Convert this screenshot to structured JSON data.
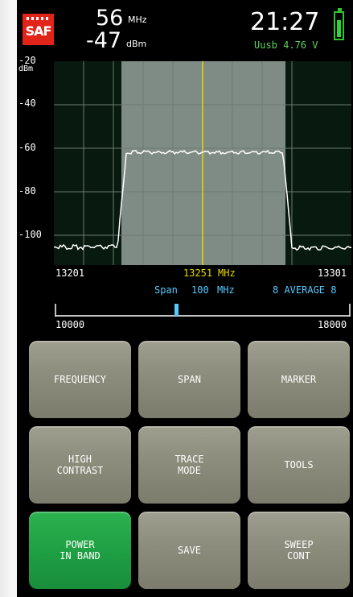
{
  "header": {
    "logo_text": "SAF",
    "frequency_value": "56",
    "frequency_unit": "MHz",
    "power_value": "-47",
    "power_unit": "dBm",
    "time": "21:27",
    "usb_voltage": "Uusb 4.76 V",
    "battery_level": 0.75
  },
  "plot": {
    "y_axis_labels": [
      "-20",
      "-40",
      "-60",
      "-80",
      "-100"
    ],
    "y_unit": "dBm",
    "x_start": "13201",
    "x_center": "13251",
    "x_center_unit": "MHz",
    "x_end": "13301",
    "span_label": "Span",
    "span_value": "100",
    "span_unit": "MHz",
    "average": "8 AVERAGE 8",
    "range_start": "10000",
    "range_end": "18000",
    "colors": {
      "background": "#08190f",
      "highlight": "#7f8c85",
      "grid": "#6d7a72",
      "trace": "#ffffff",
      "center_line": "#e8d800"
    }
  },
  "buttons": [
    {
      "label": "FREQUENCY"
    },
    {
      "label": "SPAN"
    },
    {
      "label": "MARKER"
    },
    {
      "label": "HIGH\nCONTRAST"
    },
    {
      "label": "TRACE\nMODE"
    },
    {
      "label": "TOOLS"
    },
    {
      "label": "POWER\nIN BAND",
      "active": true
    },
    {
      "label": "SAVE"
    },
    {
      "label": "SWEEP\nCONT"
    }
  ]
}
